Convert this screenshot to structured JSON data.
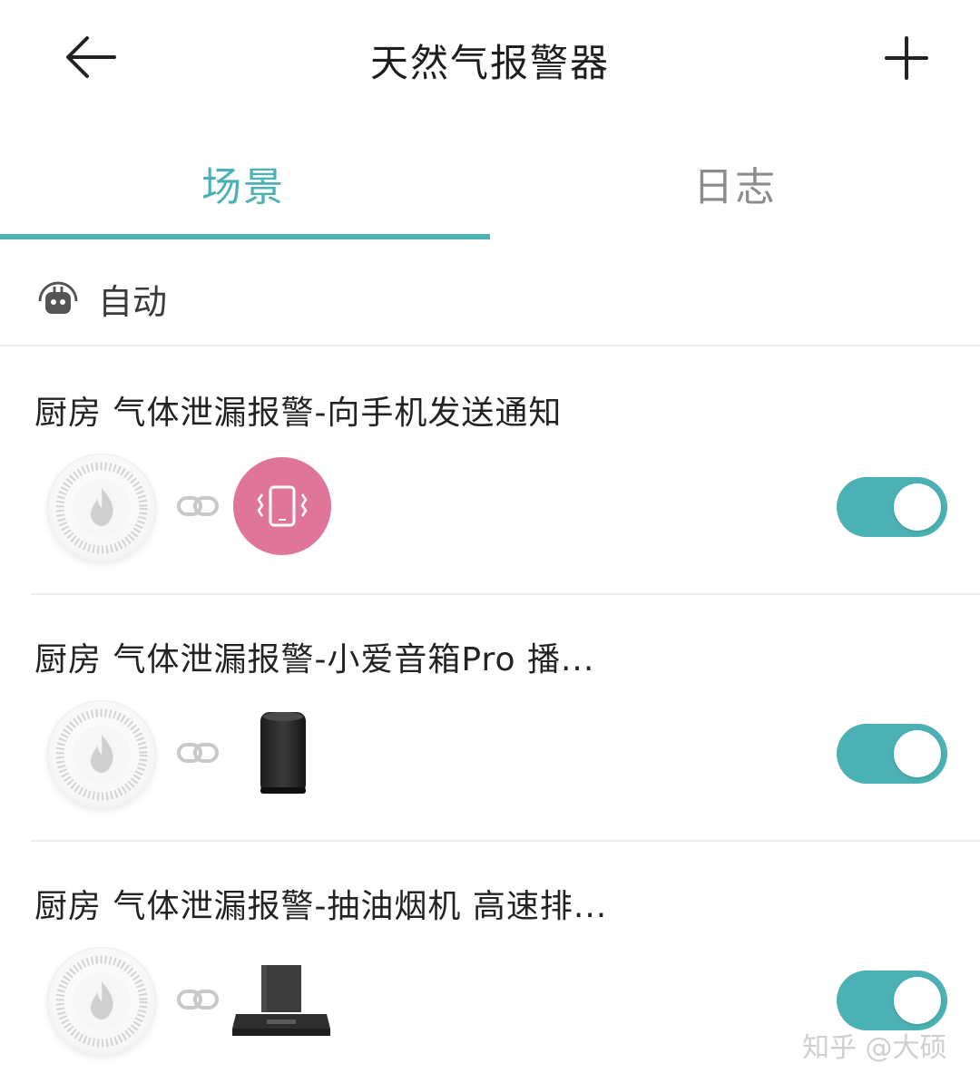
{
  "header": {
    "title": "天然气报警器",
    "back_icon": "arrow-left-icon",
    "add_icon": "plus-icon"
  },
  "tabs": [
    {
      "label": "场景",
      "active": true
    },
    {
      "label": "日志",
      "active": false
    }
  ],
  "section": {
    "label": "自动",
    "icon": "robot-icon"
  },
  "scenes": [
    {
      "title": "厨房 气体泄漏报警-向手机发送通知",
      "trigger_icon": "gas-sensor-icon",
      "action_icon": "phone-vibrate-icon",
      "enabled": true
    },
    {
      "title": "厨房 气体泄漏报警-小爱音箱Pro 播...",
      "trigger_icon": "gas-sensor-icon",
      "action_icon": "smart-speaker-icon",
      "enabled": true
    },
    {
      "title": "厨房 气体泄漏报警-抽油烟机 高速排...",
      "trigger_icon": "gas-sensor-icon",
      "action_icon": "range-hood-icon",
      "enabled": true
    }
  ],
  "watermark": "知乎 @大硕",
  "colors": {
    "accent": "#4bb1b4",
    "phone_action": "#e0759a",
    "inactive_tab": "#8c8c8c"
  }
}
